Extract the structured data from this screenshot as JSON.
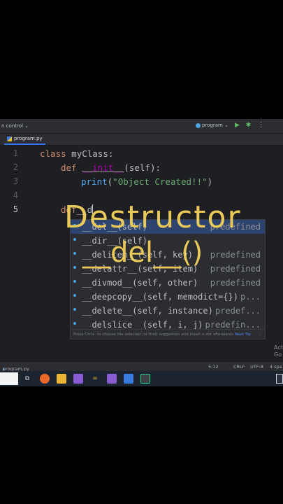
{
  "titlebar": {
    "project": "n control ⌄",
    "run_config": "program ⌄"
  },
  "tab": {
    "label": "program.py"
  },
  "line_numbers": [
    "1",
    "2",
    "3",
    "4",
    "5"
  ],
  "code": {
    "l1_kw": "class",
    "l1_rest": " myClass:",
    "l2_kw": "def",
    "l2_magic": "__init__",
    "l2_rest": "(self):",
    "l3_fn": "print",
    "l3_open": "(",
    "l3_str": "\"Object Created!!\"",
    "l3_close": ")",
    "l5_kw": "def",
    "l5_rest": "__d"
  },
  "suggestions": [
    {
      "name": "__del__(self)",
      "type": "predefined"
    },
    {
      "name": "__dir__(self)",
      "type": ""
    },
    {
      "name": "__delitem__(self, key)",
      "type": "predefined"
    },
    {
      "name": "__delattr__(self, item)",
      "type": "predefined"
    },
    {
      "name": "__divmod__(self, other)",
      "type": "predefined"
    },
    {
      "name": "__deepcopy__(self, memodict={})",
      "type": "p..."
    },
    {
      "name": "__delete__(self, instance)",
      "type": "predef..."
    },
    {
      "name": "__delslice__(self, i, j)",
      "type": "predefin..."
    }
  ],
  "popup_footer": {
    "hint": "Press Ctrl+. to choose the selected (or first) suggestion and insert a dot afterwards",
    "tip": "Next Tip"
  },
  "overlay": {
    "line1": "Destructor",
    "line2": "__del__()"
  },
  "windows_watermark": {
    "line1": "Act",
    "line2": "Go t"
  },
  "statusbar": {
    "file": "program.py",
    "position": "5:12",
    "line_sep": "CRLF",
    "encoding": "UTF-8",
    "indent": "4 spa"
  },
  "colors": {
    "editor_bg": "#1e1f22",
    "keyword": "#cf8e6d",
    "string": "#6aab73",
    "magic": "#b200b2",
    "selection": "#2e436e",
    "overlay": "#e8c95a"
  }
}
